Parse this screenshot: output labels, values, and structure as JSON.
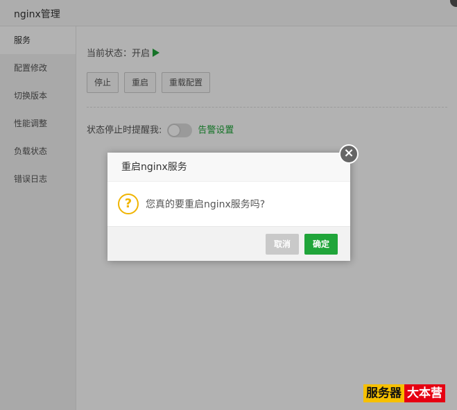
{
  "window": {
    "title": "nginx管理"
  },
  "sidebar": {
    "items": [
      {
        "label": "服务",
        "active": true
      },
      {
        "label": "配置修改"
      },
      {
        "label": "切换版本"
      },
      {
        "label": "性能调整"
      },
      {
        "label": "负载状态"
      },
      {
        "label": "错误日志"
      }
    ]
  },
  "main": {
    "status_label": "当前状态：",
    "status_value": "开启",
    "buttons": {
      "stop": "停止",
      "restart": "重启",
      "reload": "重载配置"
    },
    "alert_label": "状态停止时提醒我:",
    "alert_link": "告警设置"
  },
  "dialog": {
    "title": "重启nginx服务",
    "message": "您真的要重启nginx服务吗?",
    "cancel": "取消",
    "ok": "确定",
    "close_glyph": "×"
  },
  "watermark": {
    "part1": "服务器",
    "part2": "大本营"
  },
  "colors": {
    "accent": "#20a53a",
    "warning": "#f0b400",
    "cancel": "#c9c9c9"
  }
}
